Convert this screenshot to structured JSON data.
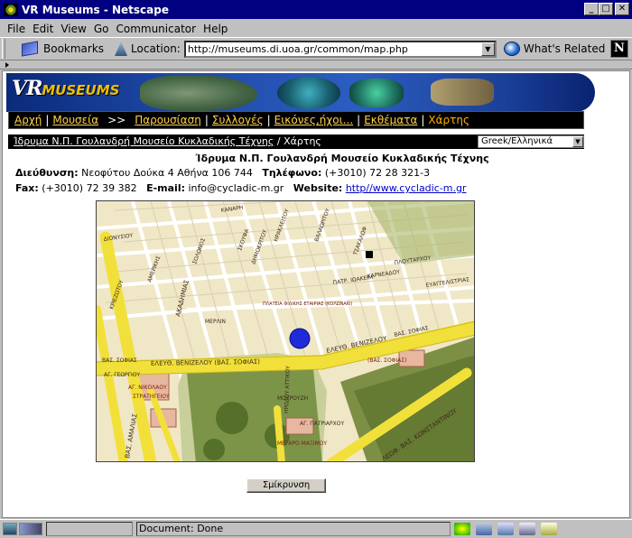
{
  "window": {
    "title": "VR Museums - Netscape"
  },
  "menu": [
    "File",
    "Edit",
    "View",
    "Go",
    "Communicator",
    "Help"
  ],
  "toolbar": {
    "bookmarks_label": "Bookmarks",
    "location_label": "Location:",
    "url": "http://museums.di.uoa.gr/common/map.php",
    "whats_related_label": "What's Related",
    "netscape_logo": "N"
  },
  "site": {
    "logo_vr": "VR",
    "logo_rest": "MUSEUMS",
    "nav": {
      "home": "Αρχή",
      "museums": "Μουσεία",
      "arrow": ">>",
      "presentation": "Παρουσίαση",
      "collections": "Συλλογές",
      "images": "Εικόνες,ήχοι...",
      "exhibits": "Εκθέματα",
      "map": "Χάρτης",
      "separators": [
        "|",
        "|",
        "|",
        "|",
        "|"
      ]
    },
    "breadcrumb": {
      "museum_link": "Ίδρυμα Ν.Π. Γουλανδρή Μουσείο Κυκλαδικής Τέχνης",
      "sep": "/",
      "current": "Χάρτης"
    },
    "language_select": "Greek/Ελληνικά"
  },
  "museum": {
    "name": "Ίδρυμα Ν.Π. Γουλανδρή Μουσείο Κυκλαδικής Τέχνης",
    "address_label": "Διεύθυνση:",
    "address": "Νεοφύτου Δούκα 4 Αθήνα 106 744",
    "phone_label": "Τηλέφωνο:",
    "phone": "(+3010) 72 28 321-3",
    "fax_label": "Fax:",
    "fax": "(+3010) 72 39 382",
    "email_label": "E-mail:",
    "email": "info@cycladic-m.gr",
    "website_label": "Website:",
    "website": "http//www.cycladic-m.gr"
  },
  "map": {
    "streets": {
      "vas_sofias_1": "ΕΛΕΥΘ. ΒΕΝΙΖΕΛΟΥ (ΒΑΣ. ΣΟΦΙΑΣ)",
      "vas_sofias_2": "ΕΛΕΥΘ. ΒΕΝΙΖΕΛΟΥ",
      "vas_sofias_3": "(ΒΑΣ. ΣΟΦΙΑΣ)",
      "akadimias": "ΑΚΑΔΗΜΙΑΣ",
      "vas_amalias": "ΒΑΣ. ΑΜΑΛΙΑΣ",
      "vas_konstantinou": "ΛΕΩΦ. ΒΑΣ. ΚΩΝΣΤΑΝΤΙΝΟΥ",
      "vas_sofias_tr": "ΒΑΣ. ΣΟΦΙΑΣ",
      "irodou_attikou": "ΗΡΩΔΟΥ ΑΤΤΙΚΟΥ",
      "mourouzi": "ΜΟΥΡΟΥΖΗ",
      "patr_ioakeim": "ΠΑΤΡ. ΙΩΑΚΕΙΜ",
      "karneadou": "ΚΑΡΝΕΑΔΟΥ",
      "ploutarchou": "ΠΛΟΥΤΑΡΧΟΥ",
      "evangelistrias": "ΕΥΑΓΓΕΛΙΣΤΡΙΑΣ",
      "dionysiou": "ΔΙΟΝΥΣΙΟΥ",
      "kanari": "ΚΑΝΑΡΗ",
      "solonos": "ΣΟΛΩΝΟΣ",
      "skoufa": "ΣΚΟΥΦΑ",
      "tsakalof": "ΤΣΑΚΑΛΩΦ",
      "amerikis": "ΑΜΕΡΙΚΗΣ",
      "kriezotou": "ΚΡΙΕΖΩΤΟΥ",
      "merlin": "ΜΕΡΛΙΝ",
      "kolonaki": "ΠΛΑΤΕΙΑ ΦΙΛΙΚΗΣ ΕΤΑΙΡΙΑΣ (ΚΟΛΩΝΑΚΙ)",
      "ag_georgiou": "ΑΓ. ΓΕΩΡΓΙΟΥ",
      "ag_nikolaou": "ΑΓ. ΝΙΚΟΛΑΟΥ",
      "stratigiou": "ΣΤΡΑΤΗΓΕΙΟΥ",
      "megaro_maximou": "ΜΕΓΑΡΟ ΜΑΞΙΜΟΥ",
      "ag_patriarchou": "ΑΓ. ΠΑΤΡΙΑΡΧΟΥ",
      "dimokritou": "ΔΗΜΟΚΡΙΤΟΥ",
      "irakleitou": "ΗΡΑΚΛΕΙΤΟΥ",
      "valaoritou": "ΒΑΛΑΩΡΙΤΟΥ",
      "vas_sofias_side": "ΒΑΣ. ΣΟΦΙΑΣ"
    }
  },
  "button": {
    "zoom_label": "Σμίκρυνση"
  },
  "status": {
    "text": "Document: Done"
  }
}
